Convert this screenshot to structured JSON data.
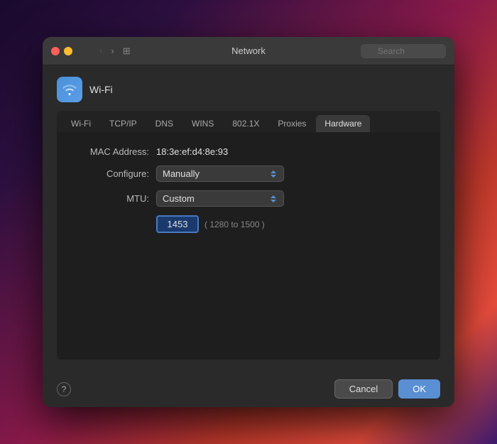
{
  "titlebar": {
    "title": "Network",
    "search_placeholder": "Search",
    "back_arrow": "‹",
    "forward_arrow": "›",
    "grid_icon": "⊞"
  },
  "wifi_section": {
    "icon_symbol": "📶",
    "label": "Wi-Fi"
  },
  "tabs": [
    {
      "id": "wifi",
      "label": "Wi-Fi",
      "active": false
    },
    {
      "id": "tcpip",
      "label": "TCP/IP",
      "active": false
    },
    {
      "id": "dns",
      "label": "DNS",
      "active": false
    },
    {
      "id": "wins",
      "label": "WINS",
      "active": false
    },
    {
      "id": "8021x",
      "label": "802.1X",
      "active": false
    },
    {
      "id": "proxies",
      "label": "Proxies",
      "active": false
    },
    {
      "id": "hardware",
      "label": "Hardware",
      "active": true
    }
  ],
  "hardware": {
    "mac_label": "MAC Address:",
    "mac_value": "18:3e:ef:d4:8e:93",
    "configure_label": "Configure:",
    "configure_value": "Manually",
    "mtu_label": "MTU:",
    "mtu_value": "Custom",
    "mtu_input": "1453",
    "mtu_range": "( 1280 to 1500 )"
  },
  "buttons": {
    "help": "?",
    "cancel": "Cancel",
    "ok": "OK"
  }
}
